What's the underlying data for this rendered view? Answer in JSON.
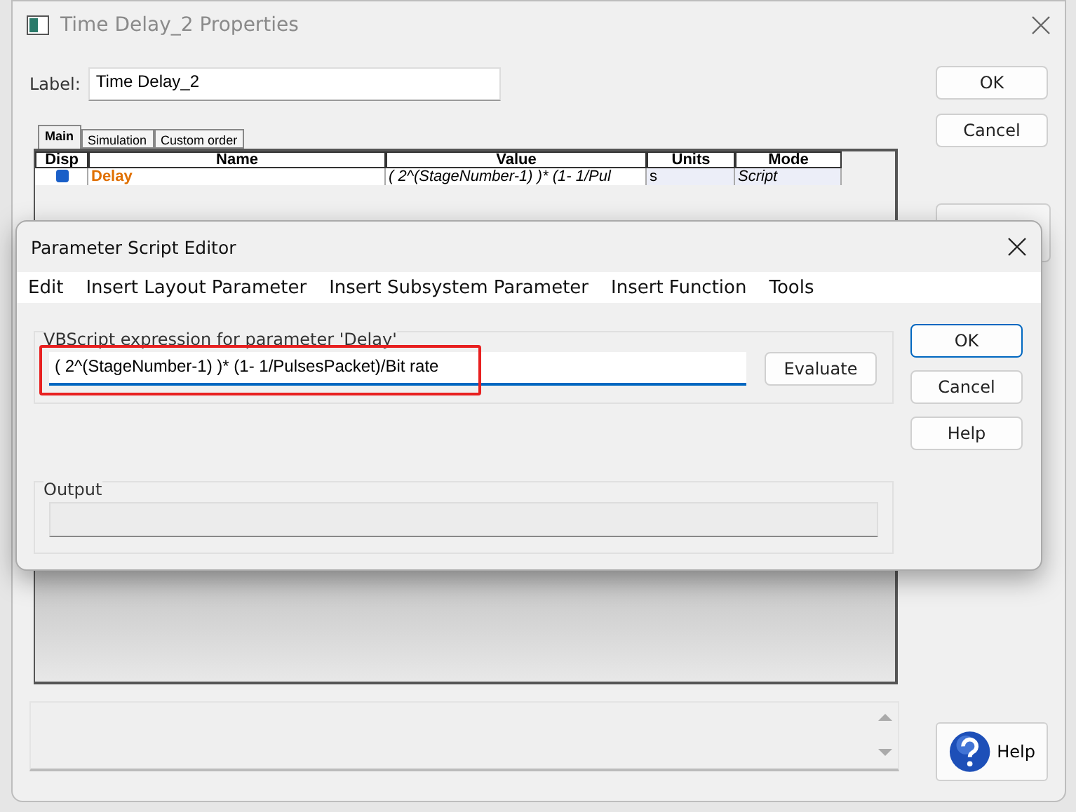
{
  "window": {
    "title": "Time Delay_2 Properties"
  },
  "label_field": {
    "label": "Label:",
    "value": "Time Delay_2"
  },
  "buttons": [
    {
      "label": "OK"
    },
    {
      "label": "Cancel"
    }
  ],
  "help_button": {
    "label": "Help"
  },
  "tabs": [
    {
      "label": "Main",
      "selected": true
    },
    {
      "label": "Simulation",
      "selected": false
    },
    {
      "label": "Custom order",
      "selected": false
    }
  ],
  "table": {
    "columns": [
      "Disp",
      "Name",
      "Value",
      "Units",
      "Mode"
    ],
    "rows": [
      {
        "disp": true,
        "name": "Delay",
        "value": "( 2^(StageNumber-1) )* (1- 1/Pul",
        "units": "s",
        "mode": "Script"
      }
    ]
  },
  "editor": {
    "title": "Parameter Script Editor",
    "menu": [
      "Edit",
      "Insert Layout Parameter",
      "Insert Subsystem Parameter",
      "Insert Function",
      "Tools"
    ],
    "expression_group": "VBScript expression for parameter 'Delay'",
    "expression": "( 2^(StageNumber-1) )* (1- 1/PulsesPacket)/Bit rate",
    "evaluate": "Evaluate",
    "output_group": "Output",
    "buttons": [
      {
        "label": "OK",
        "default": true
      },
      {
        "label": "Cancel",
        "default": false
      },
      {
        "label": "Help",
        "default": false
      }
    ]
  }
}
